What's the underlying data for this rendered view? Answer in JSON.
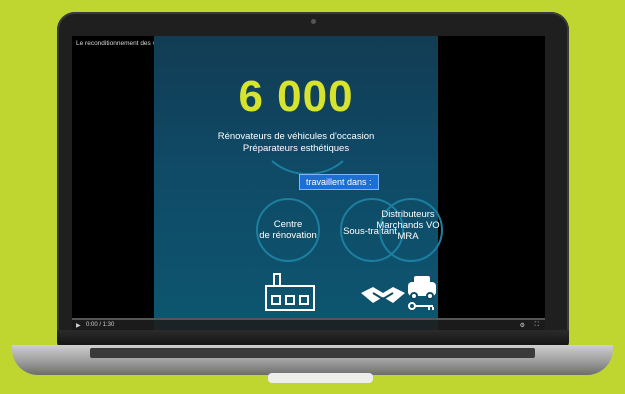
{
  "video": {
    "title": "Le reconditionnement des véhicules d'occasion",
    "time": "0:00 / 1:30",
    "controls": {
      "play": "▶",
      "settings": "⚙",
      "fullscreen": "⛶"
    }
  },
  "slide": {
    "big_number": "6 000",
    "lines": [
      "Rénovateurs de véhicules d'occasion",
      "Préparateurs esthétiques"
    ],
    "badge": "travaillent dans :",
    "categories": [
      {
        "label_lines": [
          "Centre",
          "de rénovation"
        ],
        "icon": "factory-icon"
      },
      {
        "label_lines": [
          "Sous-traitant"
        ],
        "icon": "handshake-icon"
      },
      {
        "label_lines": [
          "Distributeurs",
          "Marchands VO",
          "MRA"
        ],
        "icon": "car-key-icon"
      }
    ]
  },
  "colors": {
    "background": "#bfd630",
    "accent_number": "#d7e32c",
    "badge": "#1b6fd9",
    "slide": "#0f4a66"
  }
}
